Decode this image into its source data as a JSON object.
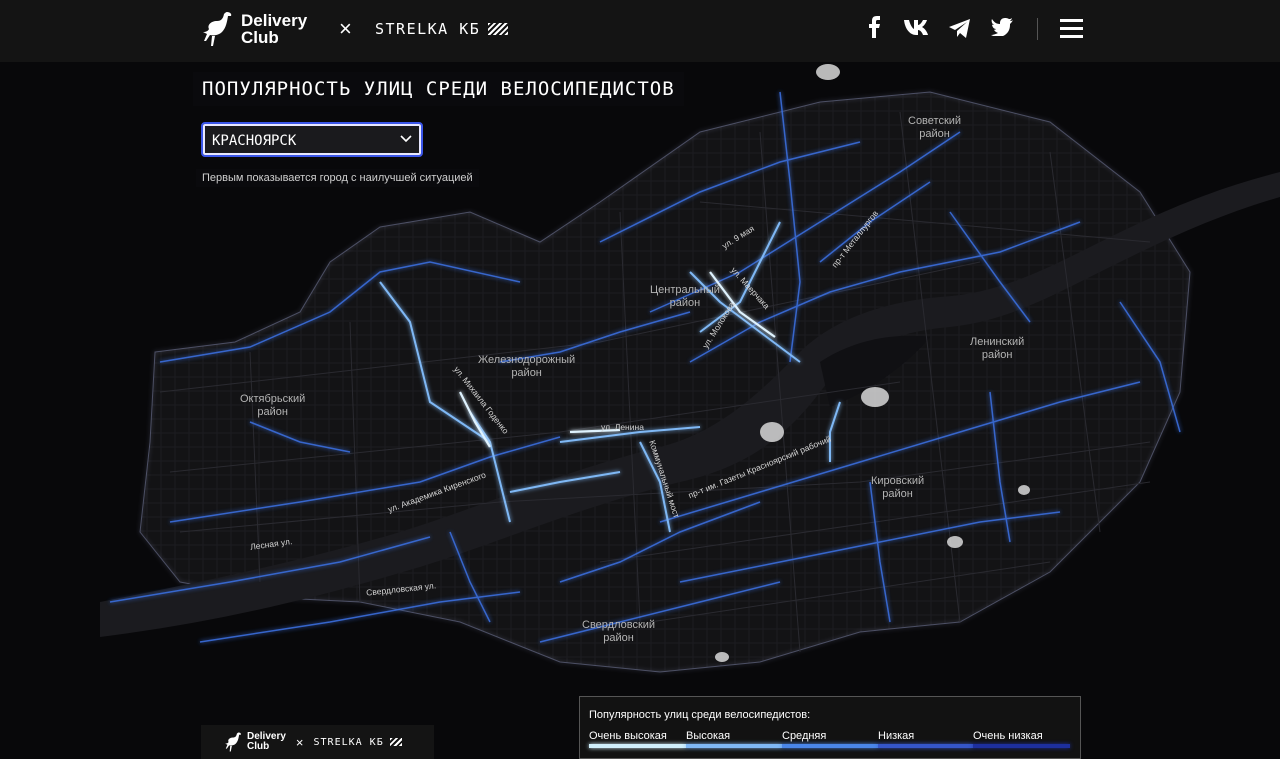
{
  "header": {
    "brand_line1": "Delivery",
    "brand_line2": "Club",
    "times": "×",
    "partner": "STRELKA КБ"
  },
  "social": [
    "facebook-icon",
    "vk-icon",
    "telegram-icon",
    "twitter-icon"
  ],
  "page": {
    "title": "ПОПУЛЯРНОСТЬ УЛИЦ СРЕДИ ВЕЛОСИПЕДИСТОВ",
    "city_select": "КРАСНОЯРСК",
    "hint": "Первым показывается город с наилучшей ситуацией"
  },
  "districts": [
    {
      "line1": "Советский",
      "line2": "район"
    },
    {
      "line1": "Центральный",
      "line2": "район"
    },
    {
      "line1": "Ленинский",
      "line2": "район"
    },
    {
      "line1": "Железнодорожный",
      "line2": "район"
    },
    {
      "line1": "Октябрьский",
      "line2": "район"
    },
    {
      "line1": "Кировский",
      "line2": "район"
    },
    {
      "line1": "Свердловский",
      "line2": "район"
    }
  ],
  "streets": [
    "ул. 9 мая",
    "пр-т Металлургов",
    "ул. Молокова",
    "ул. Маерчака",
    "ул. Михаила Годенко",
    "ул. Ленина",
    "ул. Академика Киренского",
    "Лесная ул.",
    "Свердловская ул.",
    "Коммунальный мост",
    "пр-т им. Газеты Красноярский рабочий"
  ],
  "legend": {
    "title": "Популярность улиц среди велосипедистов:",
    "levels": [
      {
        "label": "Очень высокая",
        "color": "#cfeffb"
      },
      {
        "label": "Высокая",
        "color": "#7fb8f5"
      },
      {
        "label": "Средняя",
        "color": "#4a86e8"
      },
      {
        "label": "Низкая",
        "color": "#3556c9"
      },
      {
        "label": "Очень низкая",
        "color": "#1d2f9e"
      }
    ]
  },
  "footer": {
    "brand_line1": "Delivery",
    "brand_line2": "Club",
    "times": "×",
    "partner": "STRELKA КБ"
  }
}
